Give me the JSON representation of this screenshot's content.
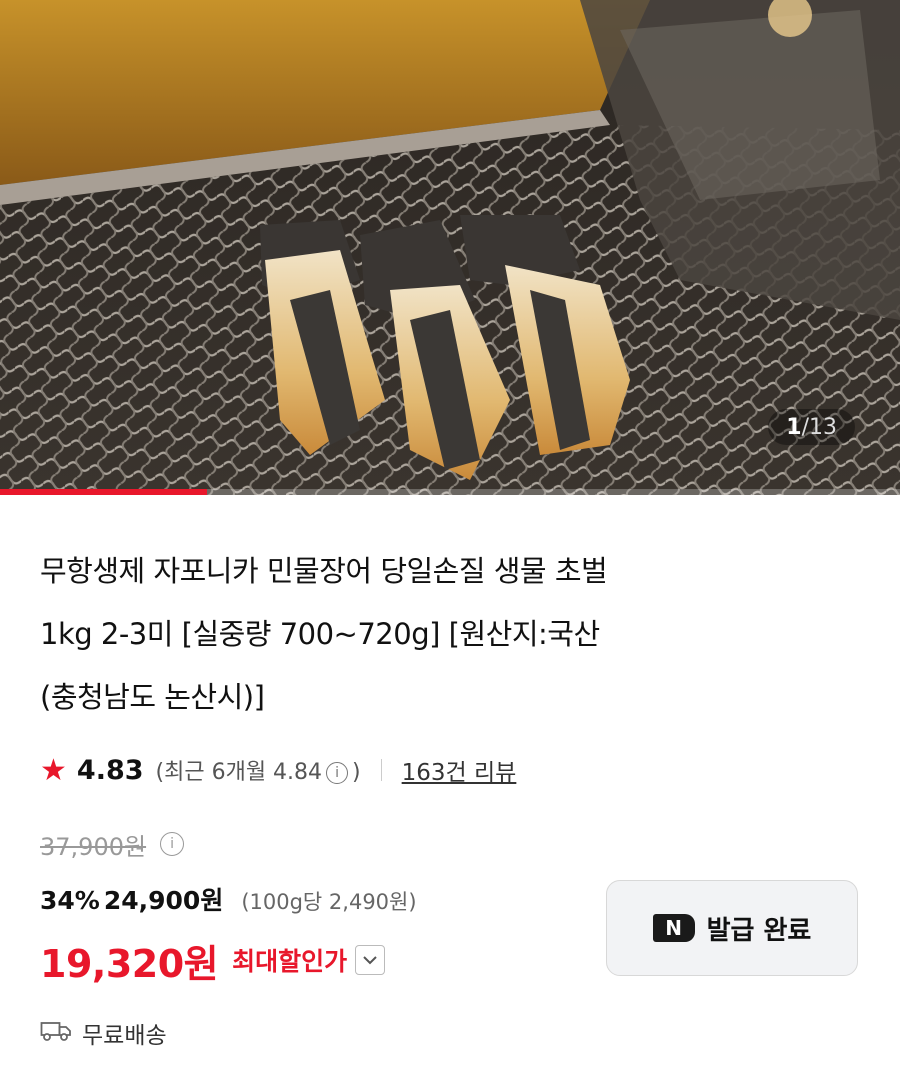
{
  "gallery": {
    "current": "1",
    "separator": "/",
    "total": "13",
    "progress": 0.23,
    "accent": "#e8172b"
  },
  "product": {
    "title_lines": [
      "무항생제 자포니카 민물장어 당일손질 생물 초벌",
      "1kg 2-3미 [실중량 700~720g] [원산지:국산",
      "(충청남도 논산시)]"
    ]
  },
  "rating": {
    "icon": "star-icon",
    "score": "4.83",
    "recent_text": "(최근 6개월 4.84",
    "recent_close": ")",
    "info_glyph": "i",
    "reviews": "163건 리뷰"
  },
  "price": {
    "original": "37,900원",
    "discount_pct": "34%",
    "sale": "24,900원",
    "unit_price": "(100g당 2,490원)",
    "final": "19,320원",
    "final_label": "최대할인가",
    "brand_color": "#e8172b"
  },
  "coupon": {
    "badge": "N",
    "label": "발급 완료"
  },
  "shipping": {
    "icon": "truck-icon",
    "label": "무료배송"
  }
}
